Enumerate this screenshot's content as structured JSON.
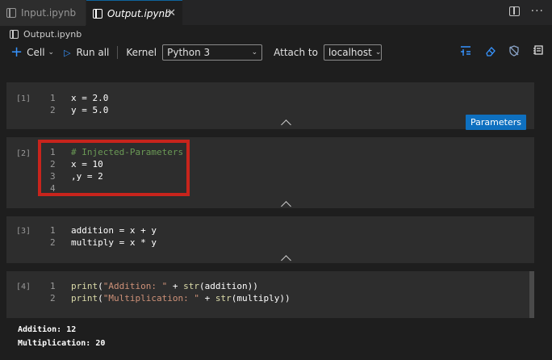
{
  "tabs": [
    {
      "label": "Input.ipynb",
      "active": false
    },
    {
      "label": "Output.ipynb",
      "active": true
    }
  ],
  "breadcrumb": {
    "file": "Output.ipynb"
  },
  "toolbar": {
    "cell_label": "Cell",
    "run_all_label": "Run all",
    "kernel_label": "Kernel",
    "kernel_value": "Python 3",
    "attach_label": "Attach to",
    "attach_value": "localhost"
  },
  "cells": [
    {
      "number": "[1]",
      "lines": [
        {
          "n": "1",
          "text": "x = 2.0"
        },
        {
          "n": "2",
          "text": "y = 5.0"
        }
      ],
      "tag": "Parameters"
    },
    {
      "number": "[2]",
      "lines": [
        {
          "n": "1",
          "text": "# Injected-Parameters"
        },
        {
          "n": "2",
          "text": "x = 10"
        },
        {
          "n": "3",
          "text": ",y = 2"
        },
        {
          "n": "4",
          "text": ""
        }
      ]
    },
    {
      "number": "[3]",
      "lines": [
        {
          "n": "1",
          "text": "addition = x + y"
        },
        {
          "n": "2",
          "text": "multiply = x * y"
        }
      ]
    },
    {
      "number": "[4]",
      "lines": [
        {
          "n": "1",
          "text": "print(\"Addition: \" + str(addition))"
        },
        {
          "n": "2",
          "text": "print(\"Multiplication: \" + str(multiply))"
        }
      ]
    }
  ],
  "output": [
    "Addition: 12",
    "Multiplication: 20"
  ],
  "colors": {
    "accent": "#0e70c0",
    "highlight": "#c8241c",
    "comment": "#6a9955",
    "string": "#ce9178"
  }
}
